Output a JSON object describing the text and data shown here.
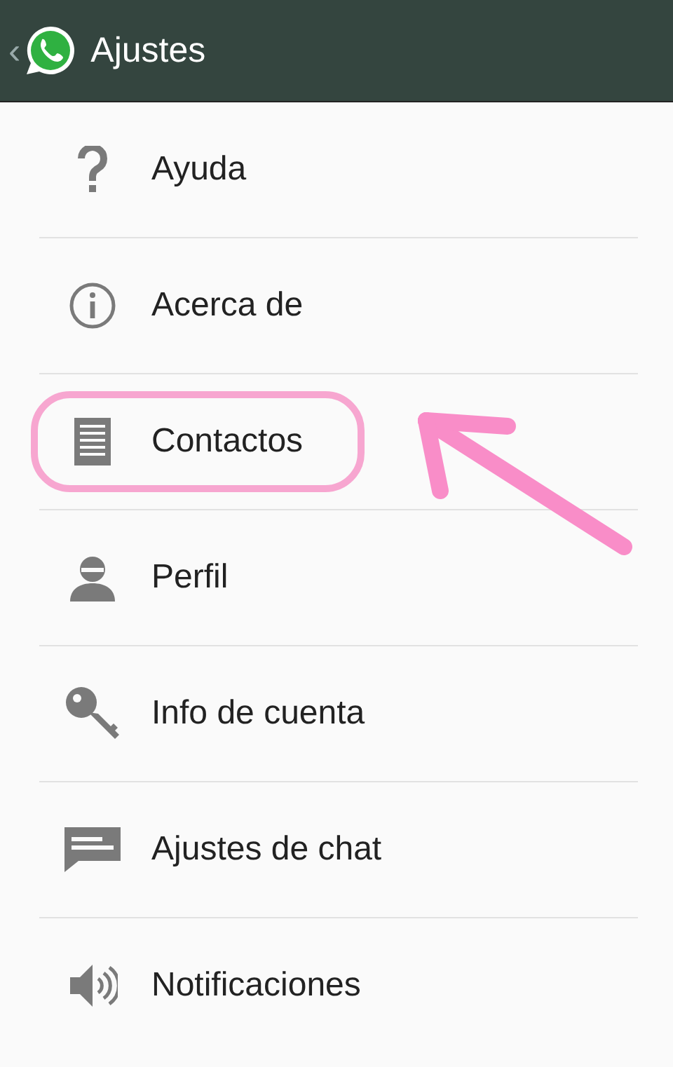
{
  "header": {
    "back": "‹",
    "title": "Ajustes"
  },
  "items": [
    {
      "kind": "help",
      "label": "Ayuda",
      "highlighted": false
    },
    {
      "kind": "info",
      "label": "Acerca de",
      "highlighted": false
    },
    {
      "kind": "contacts",
      "label": "Contactos",
      "highlighted": true
    },
    {
      "kind": "profile",
      "label": "Perfil",
      "highlighted": false
    },
    {
      "kind": "key",
      "label": "Info de cuenta",
      "highlighted": false
    },
    {
      "kind": "chat",
      "label": "Ajustes de chat",
      "highlighted": false
    },
    {
      "kind": "sound",
      "label": "Notificaciones",
      "highlighted": false
    }
  ]
}
